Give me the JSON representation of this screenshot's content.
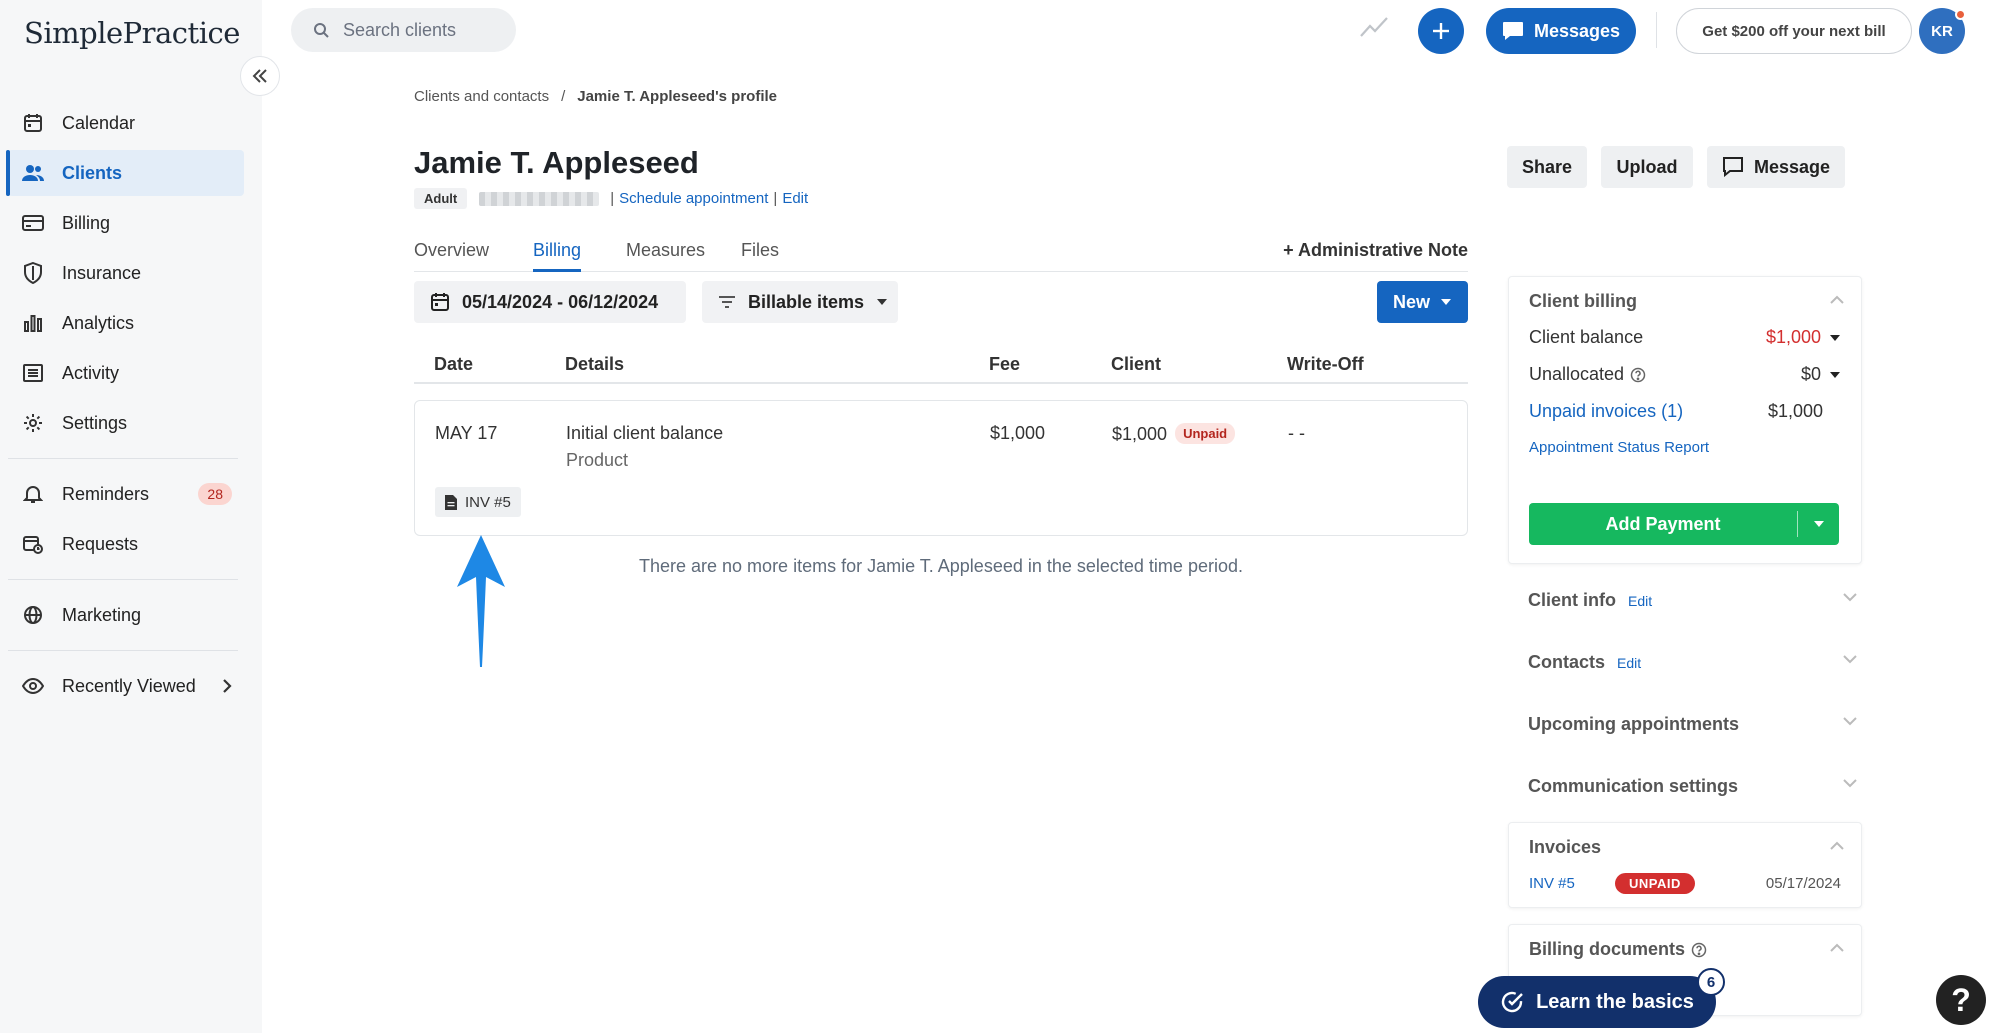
{
  "app": {
    "logo_text": "SimplePractice"
  },
  "sidebar": {
    "items": [
      {
        "label": "Calendar",
        "icon": "calendar-icon"
      },
      {
        "label": "Clients",
        "icon": "users-icon",
        "active": true
      },
      {
        "label": "Billing",
        "icon": "credit-card-icon"
      },
      {
        "label": "Insurance",
        "icon": "shield-icon"
      },
      {
        "label": "Analytics",
        "icon": "bar-chart-icon"
      },
      {
        "label": "Activity",
        "icon": "list-icon"
      },
      {
        "label": "Settings",
        "icon": "gear-icon"
      }
    ],
    "reminders": {
      "label": "Reminders",
      "count": "28"
    },
    "requests": {
      "label": "Requests"
    },
    "marketing": {
      "label": "Marketing"
    },
    "recently_viewed": {
      "label": "Recently Viewed"
    }
  },
  "topbar": {
    "search_placeholder": "Search clients",
    "messages_label": "Messages",
    "promo_label": "Get $200 off your next bill",
    "avatar_initials": "KR"
  },
  "breadcrumb": {
    "parent": "Clients and contacts",
    "separator": "/",
    "current": "Jamie T. Appleseed's profile"
  },
  "client": {
    "name": "Jamie T. Appleseed",
    "type_badge": "Adult",
    "pipe": "|",
    "schedule_link": "Schedule appointment",
    "edit_link": "Edit"
  },
  "header_actions": {
    "share": "Share",
    "upload": "Upload",
    "message": "Message"
  },
  "tabs": [
    {
      "label": "Overview"
    },
    {
      "label": "Billing",
      "active": true
    },
    {
      "label": "Measures"
    },
    {
      "label": "Files"
    }
  ],
  "admin_note_label": "+ Administrative Note",
  "filters": {
    "date_range": "05/14/2024 - 06/12/2024",
    "billable_items": "Billable items",
    "new_label": "New"
  },
  "table": {
    "headers": {
      "date": "Date",
      "details": "Details",
      "fee": "Fee",
      "client": "Client",
      "writeoff": "Write-Off"
    },
    "row": {
      "date": "MAY 17",
      "details_title": "Initial client balance",
      "details_sub": "Product",
      "fee": "$1,000",
      "client": "$1,000",
      "status": "Unpaid",
      "writeoff": "- -",
      "invoice_chip": "INV #5"
    },
    "empty_message": "There are no more items for Jamie T. Appleseed in the selected time period."
  },
  "client_billing": {
    "title": "Client billing",
    "balance_label": "Client balance",
    "balance_value": "$1,000",
    "unallocated_label": "Unallocated",
    "unallocated_value": "$0",
    "unpaid_invoices_label": "Unpaid invoices (1)",
    "unpaid_invoices_value": "$1,000",
    "report_link": "Appointment Status Report",
    "add_payment_label": "Add Payment"
  },
  "sections": {
    "client_info": "Client info",
    "contacts": "Contacts",
    "edit": "Edit",
    "upcoming": "Upcoming appointments",
    "communication": "Communication settings"
  },
  "invoices": {
    "title": "Invoices",
    "number": "INV #5",
    "status": "UNPAID",
    "date": "05/17/2024"
  },
  "billing_documents": {
    "title": "Billing documents"
  },
  "learn": {
    "label": "Learn the basics",
    "count": "6"
  },
  "help": {
    "label": "?"
  },
  "colors": {
    "brand_blue": "#1565c0",
    "green": "#16b85f",
    "red": "#d32f2f",
    "navy": "#12306b"
  }
}
